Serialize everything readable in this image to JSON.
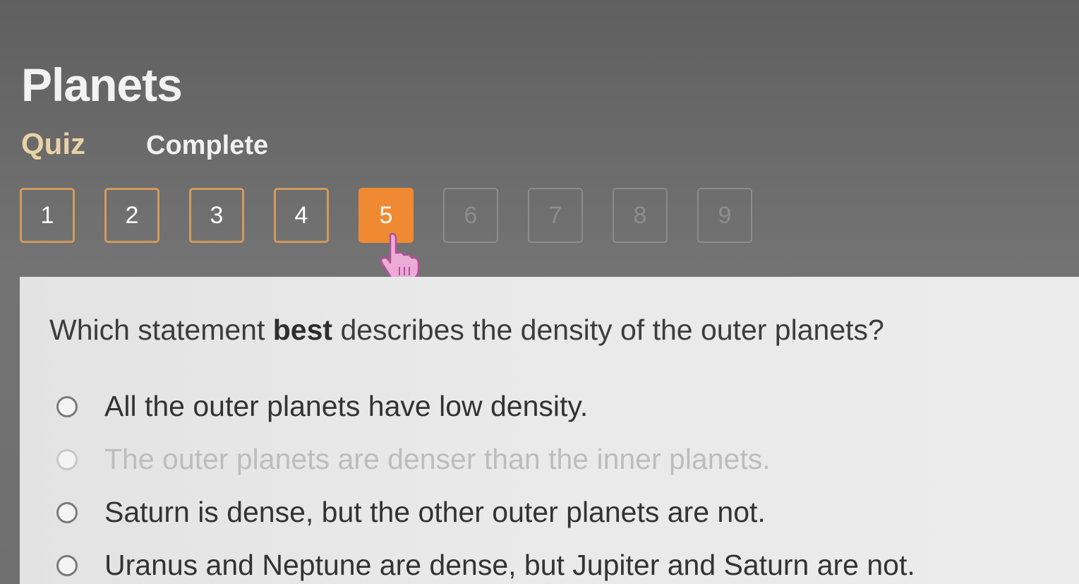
{
  "header": {
    "title": "Planets",
    "tabs": [
      "Quiz",
      "Complete"
    ]
  },
  "question_nav": {
    "items": [
      {
        "label": "1",
        "state": "answered"
      },
      {
        "label": "2",
        "state": "answered"
      },
      {
        "label": "3",
        "state": "answered"
      },
      {
        "label": "4",
        "state": "answered"
      },
      {
        "label": "5",
        "state": "current"
      },
      {
        "label": "6",
        "state": "locked"
      },
      {
        "label": "7",
        "state": "locked"
      },
      {
        "label": "8",
        "state": "locked"
      },
      {
        "label": "9",
        "state": "locked"
      }
    ],
    "current": 5,
    "accent_color": "#ef8a33"
  },
  "question": {
    "prefix": "Which statement ",
    "emphasis": "best",
    "suffix": " describes the density of the outer planets?",
    "options": [
      {
        "text": "All the outer planets have low density.",
        "state": "normal"
      },
      {
        "text": "The outer planets are denser than the inner planets.",
        "state": "dimmed"
      },
      {
        "text": "Saturn is dense, but the other outer planets are not.",
        "state": "normal"
      },
      {
        "text": "Uranus and Neptune are dense, but Jupiter and Saturn are not.",
        "state": "normal"
      }
    ]
  },
  "cursor": {
    "icon": "hand-pointer-icon"
  }
}
